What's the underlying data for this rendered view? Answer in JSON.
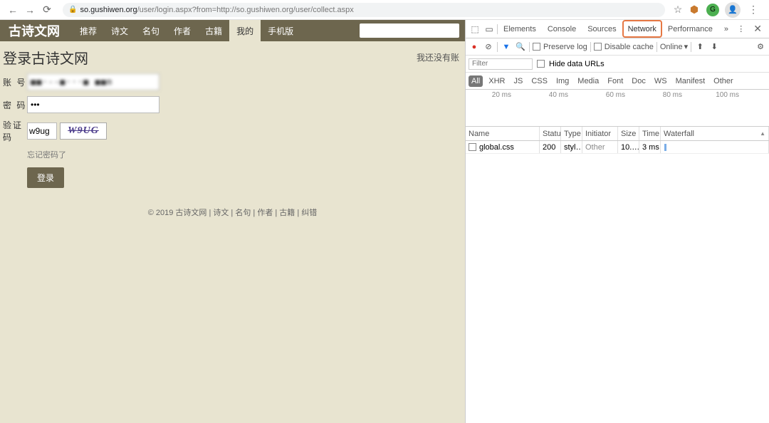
{
  "browser": {
    "url_domain": "so.gushiwen.org",
    "url_path": "/user/login.aspx?from=http://so.gushiwen.org/user/collect.aspx",
    "star_icon": "☆"
  },
  "page": {
    "logo": "古诗文网",
    "nav": [
      "推荐",
      "诗文",
      "名句",
      "作者",
      "古籍",
      "我的",
      "手机版"
    ],
    "nav_active_index": 5,
    "login_title": "登录古诗文网",
    "no_account": "我还没有账",
    "form": {
      "username_label": "账  号",
      "username_value": "■■·--■···■ ■■m",
      "password_label": "密  码",
      "password_value": "•••",
      "captcha_label": "验证码",
      "captcha_input": "w9ug",
      "captcha_image": "W9UG",
      "forgot": "忘记密码了",
      "submit": "登录"
    },
    "footer": "© 2019 古诗文网 | 诗文 | 名句 | 作者 | 古籍 | 纠错"
  },
  "devtools": {
    "tabs": [
      "Elements",
      "Console",
      "Sources",
      "Network",
      "Performance"
    ],
    "active_tab": "Network",
    "toolbar": {
      "preserve_log": "Preserve log",
      "disable_cache": "Disable cache",
      "online": "Online"
    },
    "filter_placeholder": "Filter",
    "hide_data_urls": "Hide data URLs",
    "type_filters": [
      "All",
      "XHR",
      "JS",
      "CSS",
      "Img",
      "Media",
      "Font",
      "Doc",
      "WS",
      "Manifest",
      "Other"
    ],
    "timeline_labels": [
      "20 ms",
      "40 ms",
      "60 ms",
      "80 ms",
      "100 ms"
    ],
    "columns": [
      "Name",
      "Status",
      "Type",
      "Initiator",
      "Size",
      "Time",
      "Waterfall"
    ],
    "rows": [
      {
        "name": "global.css",
        "status": "200",
        "type": "styl…",
        "initiator": "Other",
        "size": "10.…",
        "time": "3 ms"
      }
    ]
  }
}
